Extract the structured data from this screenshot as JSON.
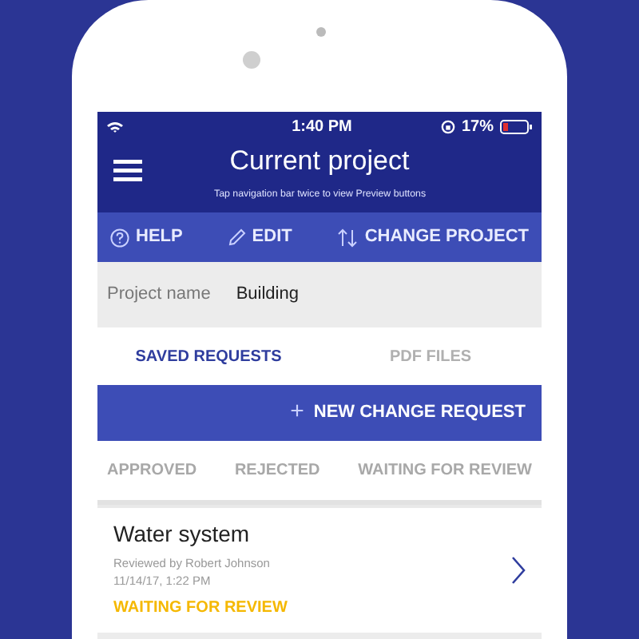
{
  "status_bar": {
    "time": "1:40 PM",
    "battery": "17%"
  },
  "header": {
    "title": "Current project",
    "hint": "Tap navigation bar twice to view Preview buttons"
  },
  "toolbar": [
    {
      "kind": "help",
      "label": "HELP"
    },
    {
      "kind": "edit",
      "label": "EDIT"
    },
    {
      "kind": "swap",
      "label": "CHANGE PROJECT"
    }
  ],
  "project": {
    "label": "Project name",
    "value": "Building"
  },
  "tabs": [
    {
      "label": "SAVED REQUESTS",
      "selected": true
    },
    {
      "label": "PDF FILES",
      "selected": false
    }
  ],
  "new_request_button": {
    "icon": "+",
    "label": "NEW CHANGE REQUEST"
  },
  "filters": [
    {
      "label": "APPROVED",
      "selected": false
    },
    {
      "label": "REJECTED",
      "selected": false
    },
    {
      "label": "WAITING FOR REVIEW",
      "selected": false
    }
  ],
  "requests": [
    {
      "title": "Water system",
      "reviewer": "Reviewed by Robert Johnson",
      "date": "11/14/17, 1:22 PM",
      "status": "WAITING FOR REVIEW",
      "color": "#f5b800"
    }
  ]
}
